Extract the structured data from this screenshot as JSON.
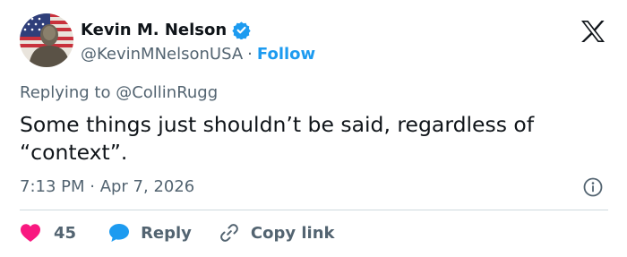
{
  "author": {
    "name": "Kevin M. Nelson",
    "handle": "@KevinMNelsonUSA",
    "separator": "·",
    "follow_label": "Follow"
  },
  "reply_context": {
    "prefix": "Replying to ",
    "mention": "@CollinRugg"
  },
  "tweet": {
    "text": "Some things just shouldn’t be said, regardless of “context”.",
    "timestamp": "7:13 PM · Apr 7, 2026"
  },
  "actions": {
    "like_count": "45",
    "reply_label": "Reply",
    "copy_label": "Copy link"
  },
  "colors": {
    "accent": "#1d9bf0",
    "like": "#f91880",
    "text": "#0f1419",
    "muted": "#536471",
    "divider": "#cfd9de"
  },
  "icons": [
    "verified-badge-icon",
    "x-logo-icon",
    "info-icon",
    "heart-icon",
    "speech-bubble-icon",
    "link-icon"
  ]
}
